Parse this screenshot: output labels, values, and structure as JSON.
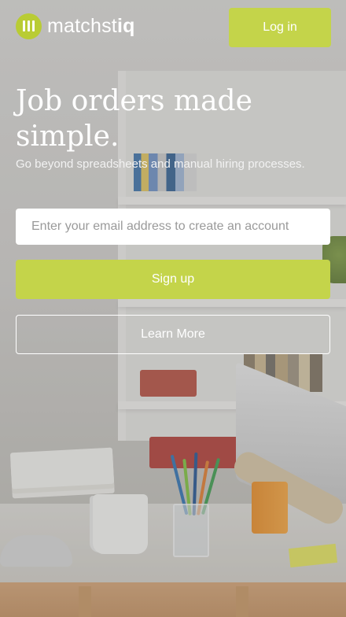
{
  "header": {
    "logo_text_regular": "matchst",
    "logo_text_bold": "iq",
    "login_label": "Log in"
  },
  "hero": {
    "title": "Job orders made simple.",
    "subtitle": "Go beyond spreadsheets and manual hiring processes."
  },
  "signup_form": {
    "email_placeholder": "Enter your email address to create an account",
    "email_value": "",
    "signup_label": "Sign up",
    "learn_more_label": "Learn More"
  },
  "colors": {
    "accent": "#c4d44a",
    "logo_mark": "#b9cc34",
    "text_on_image": "#ffffff"
  },
  "icons": {
    "logo": "matchstiq-logo-icon"
  }
}
